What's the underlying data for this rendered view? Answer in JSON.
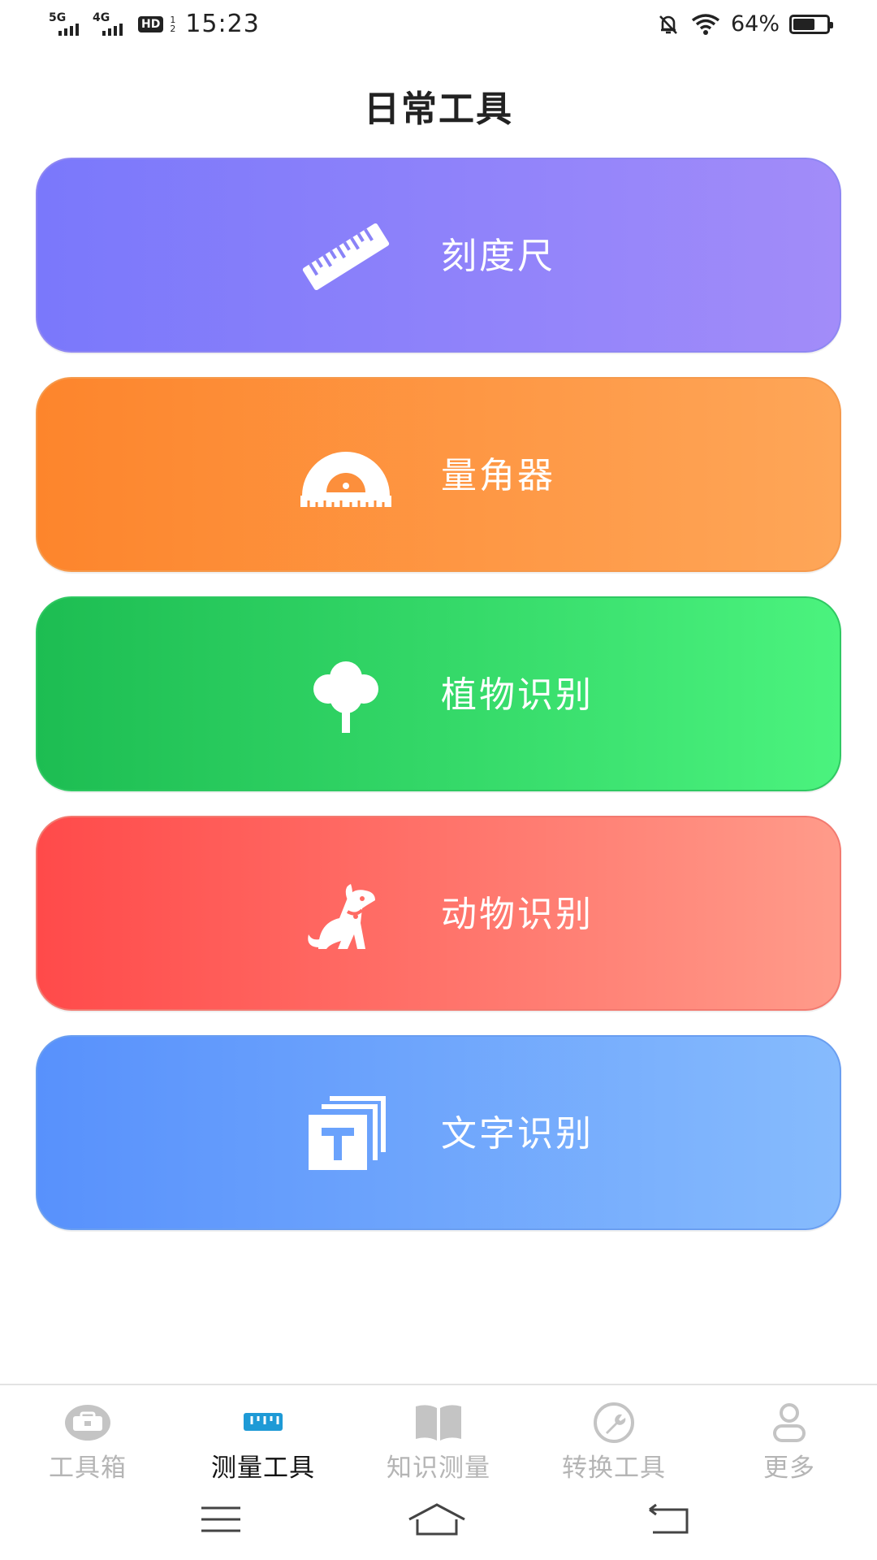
{
  "status_bar": {
    "sig1_label": "5G",
    "sig2_label": "4G",
    "hd_label": "HD",
    "hd_sub_top": "1",
    "hd_sub_bottom": "2",
    "time": "15:23",
    "battery_percent_text": "64%",
    "battery_level": 0.64
  },
  "title": "日常工具",
  "cards": [
    {
      "label": "刻度尺",
      "icon": "ruler-icon"
    },
    {
      "label": "量角器",
      "icon": "protractor-icon"
    },
    {
      "label": "植物识别",
      "icon": "tree-icon"
    },
    {
      "label": "动物识别",
      "icon": "dog-icon"
    },
    {
      "label": "文字识别",
      "icon": "text-recognition-icon"
    }
  ],
  "bottom_nav": [
    {
      "label": "工具箱",
      "icon": "toolbox-icon",
      "active": false
    },
    {
      "label": "测量工具",
      "icon": "ruler-tab-icon",
      "active": true
    },
    {
      "label": "知识测量",
      "icon": "book-icon",
      "active": false
    },
    {
      "label": "转换工具",
      "icon": "wrench-icon",
      "active": false
    },
    {
      "label": "更多",
      "icon": "person-icon",
      "active": false
    }
  ],
  "colors": {
    "active_tab_icon": "#1e9ad6",
    "inactive_tab": "#b5b5b5"
  }
}
